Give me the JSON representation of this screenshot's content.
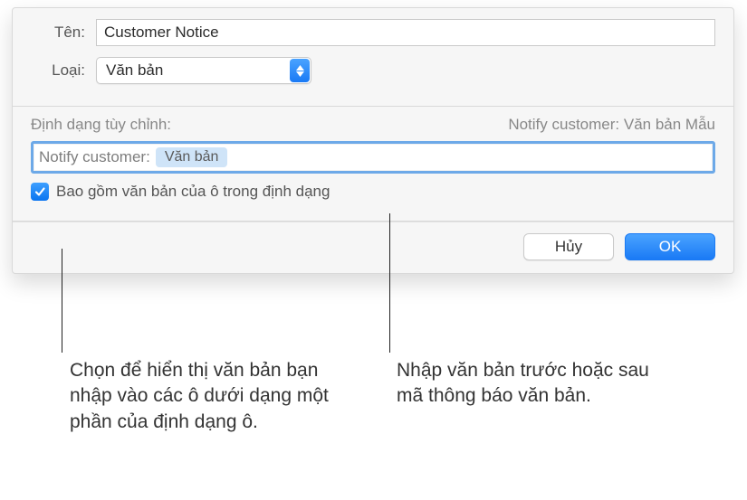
{
  "dialog": {
    "name_label": "Tên:",
    "name_value": "Customer Notice",
    "type_label": "Loại:",
    "type_value": "Văn bản",
    "custom_format_label": "Định dạng tùy chỉnh:",
    "sample_label": "Notify customer: Văn bản Mẫu",
    "format_prefix": "Notify customer:",
    "format_token": "Văn bản",
    "checkbox_label": "Bao gồm văn bản của ô trong định dạng",
    "checkbox_checked": true,
    "cancel_label": "Hủy",
    "ok_label": "OK"
  },
  "callouts": {
    "left": "Chọn để hiển thị văn bản bạn nhập vào các ô dưới dạng một phần của định dạng ô.",
    "right": "Nhập văn bản trước hoặc sau mã thông báo văn bản."
  }
}
